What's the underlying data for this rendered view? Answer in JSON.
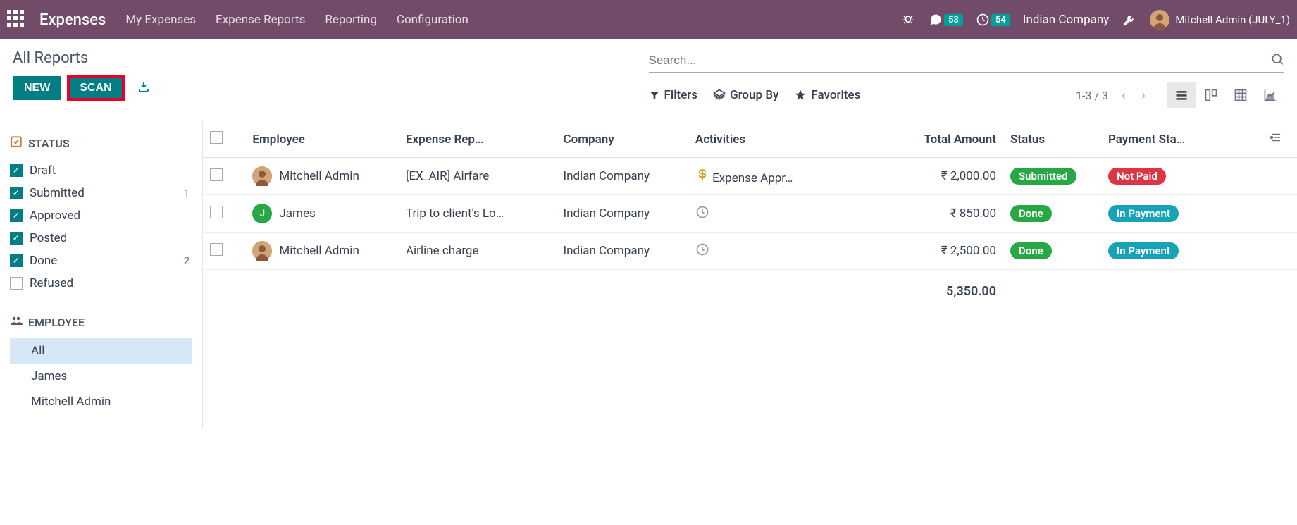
{
  "navbar": {
    "app_title": "Expenses",
    "menu": [
      "My Expenses",
      "Expense Reports",
      "Reporting",
      "Configuration"
    ],
    "messages_count": "53",
    "activities_count": "54",
    "company": "Indian Company",
    "user": "Mitchell Admin (JULY_1)"
  },
  "breadcrumb": "All Reports",
  "buttons": {
    "new": "NEW",
    "scan": "SCAN"
  },
  "search": {
    "placeholder": "Search..."
  },
  "toolbar": {
    "filters": "Filters",
    "groupby": "Group By",
    "favorites": "Favorites"
  },
  "pager": {
    "range": "1-3 / 3"
  },
  "sidebar": {
    "status_header": "STATUS",
    "statuses": [
      {
        "label": "Draft",
        "checked": true,
        "count": ""
      },
      {
        "label": "Submitted",
        "checked": true,
        "count": "1"
      },
      {
        "label": "Approved",
        "checked": true,
        "count": ""
      },
      {
        "label": "Posted",
        "checked": true,
        "count": ""
      },
      {
        "label": "Done",
        "checked": true,
        "count": "2"
      },
      {
        "label": "Refused",
        "checked": false,
        "count": ""
      }
    ],
    "employee_header": "EMPLOYEE",
    "employees": [
      {
        "label": "All",
        "active": true
      },
      {
        "label": "James",
        "active": false
      },
      {
        "label": "Mitchell Admin",
        "active": false
      }
    ]
  },
  "table": {
    "headers": {
      "employee": "Employee",
      "report": "Expense Rep…",
      "company": "Company",
      "activities": "Activities",
      "amount": "Total Amount",
      "status": "Status",
      "payment": "Payment Sta…"
    },
    "rows": [
      {
        "employee": "Mitchell Admin",
        "avatar_class": "",
        "avatar_letter": "",
        "report": "[EX_AIR] Airfare",
        "company": "Indian Company",
        "activity_icon": "dollar",
        "activity_text": "Expense Appr…",
        "amount": "₹ 2,000.00",
        "status": "Submitted",
        "status_class": "pill-submitted",
        "payment": "Not Paid",
        "payment_class": "pill-notpaid"
      },
      {
        "employee": "James",
        "avatar_class": "green",
        "avatar_letter": "J",
        "report": "Trip to client's Lo…",
        "company": "Indian Company",
        "activity_icon": "clock",
        "activity_text": "",
        "amount": "₹ 850.00",
        "status": "Done",
        "status_class": "pill-done",
        "payment": "In Payment",
        "payment_class": "pill-inpayment"
      },
      {
        "employee": "Mitchell Admin",
        "avatar_class": "",
        "avatar_letter": "",
        "report": "Airline charge",
        "company": "Indian Company",
        "activity_icon": "clock",
        "activity_text": "",
        "amount": "₹ 2,500.00",
        "status": "Done",
        "status_class": "pill-done",
        "payment": "In Payment",
        "payment_class": "pill-inpayment"
      }
    ],
    "total": "5,350.00"
  }
}
